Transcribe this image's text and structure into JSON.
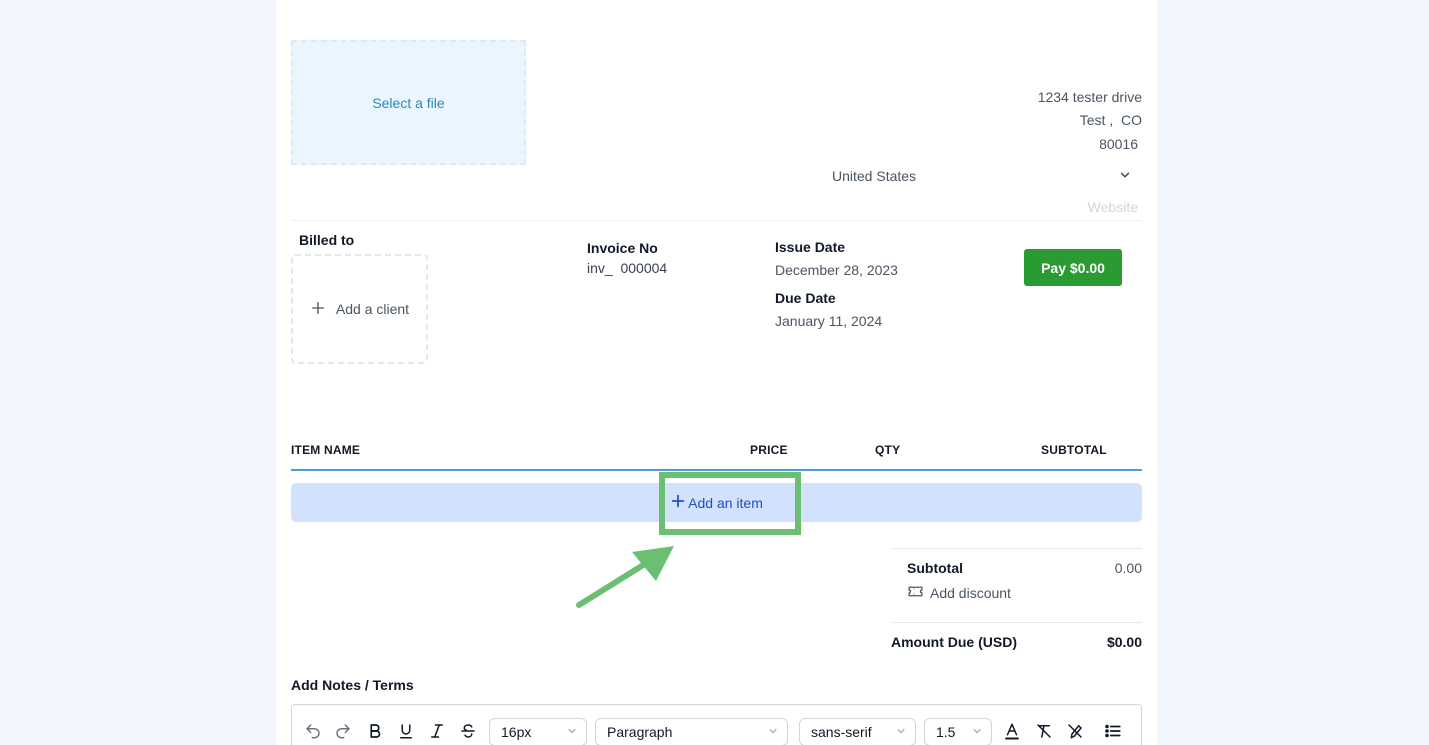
{
  "logo_upload": {
    "label": "Select a file"
  },
  "sender": {
    "street": "1234 tester drive",
    "city": "Test",
    "state": "CO",
    "zip": "80016",
    "country": "United States",
    "website_placeholder": "Website"
  },
  "billed_to": {
    "label": "Billed to",
    "add_client": "Add a client"
  },
  "invoice": {
    "number_label": "Invoice No",
    "prefix": "inv_",
    "number": "000004"
  },
  "dates": {
    "issue_label": "Issue Date",
    "issue_value": "December 28, 2023",
    "due_label": "Due Date",
    "due_value": "January 11, 2024"
  },
  "pay_button": "Pay $0.00",
  "items_table": {
    "headers": [
      "ITEM NAME",
      "PRICE",
      "QTY",
      "SUBTOTAL"
    ],
    "add_item": "Add an item"
  },
  "totals": {
    "subtotal_label": "Subtotal",
    "subtotal_value": "0.00",
    "add_discount": "Add discount",
    "amount_due_label": "Amount Due (USD)",
    "amount_due_value": "$0.00"
  },
  "notes": {
    "label": "Add Notes / Terms",
    "toolbar": {
      "font_size": "16px",
      "block_type": "Paragraph",
      "font_family": "sans-serif",
      "line_height": "1.5"
    }
  },
  "colors": {
    "accent": "#4a9bd6",
    "pay_button": "#2a9b33",
    "highlight": "#6bbf73",
    "add_item_bg": "#d2e2fd"
  }
}
